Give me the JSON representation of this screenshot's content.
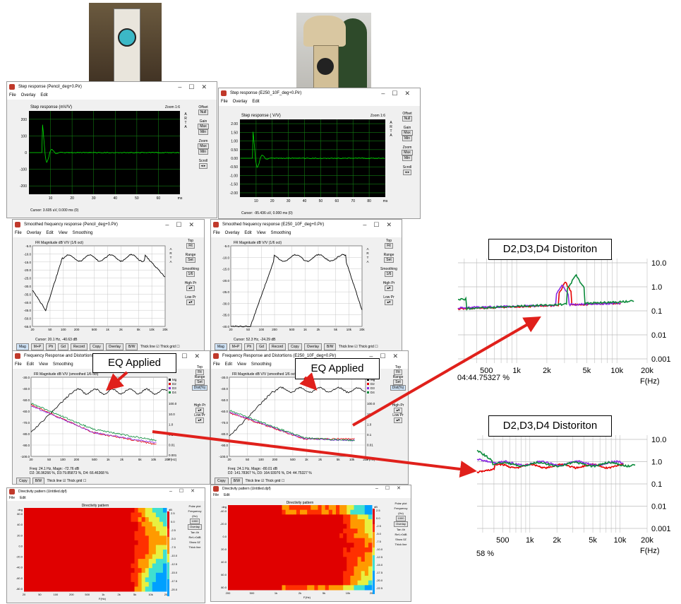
{
  "photos": {
    "left_alt": "pencil speaker photo",
    "right_alt": "horn speaker photo"
  },
  "step_left": {
    "title": "Step response (Pencil_deg+0.Pir)",
    "menu": [
      "File",
      "Overlay",
      "Edit"
    ],
    "plot_title": "Step response (mV/V)",
    "zoom": "Zoom 1:6",
    "y_ticks": [
      "200",
      "100",
      "0",
      "-100",
      "-200"
    ],
    "x_ticks": [
      "10",
      "20",
      "30",
      "40",
      "50",
      "60",
      "ms"
    ],
    "cursor": "Cursor:  3.605 uV,  0.000 ms  (0)",
    "side": {
      "offset": "Offset",
      "null": "Null",
      "gain": "Gain",
      "max": "Max",
      "min": "Min",
      "zoom": "Zoom",
      "scroll": "Scroll"
    }
  },
  "step_right": {
    "title": "Step response (E250_10F_deg+0.Pir)",
    "menu": [
      "File",
      "Overlay",
      "Edit"
    ],
    "plot_title": "Step response ( V/V)",
    "zoom": "Zoom 1:6",
    "y_ticks": [
      "2.00",
      "1.50",
      "1.00",
      "0.50",
      "0.00",
      "-0.50",
      "-1.00",
      "-1.50",
      "-2.00"
    ],
    "x_ticks": [
      "10",
      "20",
      "30",
      "40",
      "50",
      "60",
      "70",
      "80",
      "ms"
    ],
    "cursor": "Cursor:  -95.436 uV,  0.000 ms  (0)",
    "side": {
      "offset": "Offset",
      "null": "Null",
      "gain": "Gain",
      "max": "Max",
      "min": "Min",
      "zoom": "Zoom",
      "scroll": "Scroll"
    }
  },
  "fr_left": {
    "title": "Smoothed frequency response (Pencil_deg+0.Pir)",
    "menu": [
      "File",
      "Overlay",
      "Edit",
      "View",
      "Smoothing"
    ],
    "plot_title": "FR Magnitude dB V/V (1/6 oct)",
    "y_ticks": [
      "-5.0",
      "-10.0",
      "-15.0",
      "-20.0",
      "-25.0",
      "-30.0",
      "-35.0",
      "-40.0",
      "-45.0",
      "-50.0",
      "-55.0"
    ],
    "x_ticks": [
      "20",
      "50",
      "100",
      "200",
      "500",
      "1k",
      "2k",
      "5k",
      "10k",
      "20k"
    ],
    "cursor": "Cursor: 20.1 Hz, -40.63 dB",
    "toolbar": [
      "Mag",
      "M+P",
      "Ph",
      "Gd",
      "Record",
      "Copy",
      "Overlay",
      "B/W",
      "Thick line",
      "Thick grid"
    ],
    "side": {
      "top": "Top",
      "fit": "Fit",
      "range": "Range",
      "set": "Set",
      "smoothing": "Smoothing",
      "smooth_val": "1/6",
      "high": "High Pr",
      "low": "Low Pr"
    }
  },
  "fr_right": {
    "title": "Smoothed frequency response (E250_10F_deg+0.Pir)",
    "menu": [
      "File",
      "Overlay",
      "Edit",
      "View",
      "Smoothing"
    ],
    "plot_title": "FR Magnitude dB V/V (1/6 oct)",
    "y_ticks": [
      "-5.0",
      "-10.0",
      "-15.0",
      "-20.0",
      "-25.0",
      "-30.0",
      "-35.0",
      "-40.0"
    ],
    "x_ticks": [
      "20",
      "50",
      "100",
      "200",
      "500",
      "1k",
      "2k",
      "5k",
      "10k",
      "20k"
    ],
    "cursor": "Cursor: 52.3 Hz, -24.29 dB",
    "toolbar": [
      "Mag",
      "M+P",
      "Ph",
      "Gd",
      "Record",
      "Copy",
      "Overlay",
      "B/W",
      "Thick line",
      "Thick grid"
    ],
    "side": {
      "top": "Top",
      "fit": "Fit",
      "range": "Range",
      "set": "Set",
      "smoothing": "Smoothing",
      "smooth_val": "1/6",
      "high": "High Pr",
      "low": "Low Pr"
    }
  },
  "dist_left": {
    "title": "Frequency Response and Distortions (Distortion.Pir)",
    "menu": [
      "File",
      "Edit",
      "View",
      "Smoothing"
    ],
    "plot_title": "FR Magnitude dB V/V (smoothed 1/6 oct)",
    "y_ticks": [
      "-30.0",
      "-40.0",
      "-50.0",
      "-60.0",
      "-70.0",
      "-80.0",
      "-90.0",
      "-100.0"
    ],
    "r_ticks": [
      "100.0",
      "10.0",
      "1.0",
      "0.1",
      "0.01",
      "0.001"
    ],
    "x_ticks": [
      "20",
      "50",
      "100",
      "200",
      "500",
      "1k",
      "2k",
      "5k",
      "10k",
      "20k"
    ],
    "xunit": "F(Hz)",
    "legend": [
      "Mg",
      "D2",
      "D3",
      "D4"
    ],
    "freq_line": "Freq: 24.1 Hz, Magn: -72.76 dB",
    "dist_line": "D2: 36.96266 %,  D3:79.85873 %,  D4: 66.46368 %",
    "toolbar": [
      "Copy",
      "B/W",
      "Thick line",
      "Thick grid"
    ],
    "side": {
      "top": "Top",
      "fit": "Fit",
      "range": "Range",
      "set": "Set",
      "dist": "Dist(%)",
      "high": "High Pr",
      "low": "Low Pr"
    }
  },
  "dist_right": {
    "title": "Frequency Response and Distortions (E250_10F_deg+0.Pir)",
    "menu": [
      "File",
      "Edit",
      "View",
      "Smoothing"
    ],
    "plot_title": "FR Magnitude dB V/V (smoothed 1/6 oct)",
    "y_ticks": [
      "-30.0",
      "-40.0",
      "-50.0",
      "-60.0",
      "-70.0",
      "-80.0",
      "-90.0",
      "-100.0"
    ],
    "r_ticks": [
      "100.0",
      "10.0",
      "1.0",
      "0.1",
      "0.01"
    ],
    "x_ticks": [
      "20",
      "50",
      "100",
      "200",
      "500",
      "1k",
      "2k",
      "5k",
      "10k",
      "20k"
    ],
    "xunit": "F(Hz)",
    "legend": [
      "Mg",
      "D2",
      "D3",
      "D4"
    ],
    "freq_line": "Freq: 24.1 Hz, Magn: -80.01 dB",
    "dist_line": "D2: 141.78367 %,  D3: 164.93976 %,  D4: 44.75327 %",
    "toolbar": [
      "Copy",
      "B/W",
      "Thick line",
      "Thick grid"
    ],
    "side": {
      "top": "Top",
      "fit": "Fit",
      "range": "Range",
      "set": "Set",
      "dist": "Dist(%)",
      "high": "High Pr",
      "low": "Low Pr"
    }
  },
  "dir_left": {
    "title": "Directivity pattern (Untitled.dpf)",
    "menu": [
      "File",
      "Edit"
    ],
    "plot_title": "Directivity pattern",
    "y_label": "deg",
    "y_ticks": [
      "60.0",
      "40.0",
      "20.0",
      "0.0",
      "-20.0",
      "-40.0",
      "-60.0",
      "-80.0"
    ],
    "x_ticks": [
      "20",
      "50",
      "100",
      "200",
      "500",
      "1k",
      "2k",
      "5k",
      "10k",
      "20k"
    ],
    "x_unit": "F(Hz)",
    "scale_unit": "dB",
    "scale": [
      "2.5",
      "0.0",
      "-2.5",
      "-5.0",
      "-7.5",
      "-10.0",
      "-12.5",
      "-15.0",
      "-17.5",
      "-20.0"
    ],
    "side": [
      "Polar plot",
      "Frequency (Hz)",
      "1000",
      "Overlay",
      "Tan 4h",
      "Ref->0dB",
      "Show 0Z",
      "Thick line"
    ]
  },
  "dir_right": {
    "title": "Directivity pattern (Untitled.dpf)",
    "menu": [
      "File",
      "Edit"
    ],
    "plot_title": "Directivity pattern",
    "y_label": "deg",
    "y_ticks": [
      "-40.0",
      "-20.0",
      "0.0",
      "20.0",
      "40.0",
      "60.0",
      "80.0"
    ],
    "x_ticks": [
      "200",
      "500",
      "1k",
      "2k",
      "5k",
      "10k",
      "20k"
    ],
    "x_unit": "F(Hz)",
    "scale_unit": "dB",
    "scale": [
      "2.5",
      "0.0",
      "-2.5",
      "-5.0",
      "-7.5",
      "-10.0",
      "-12.5",
      "-15.0",
      "-17.5",
      "-20.0",
      "-22.5"
    ],
    "side": [
      "Polar plot",
      "Frequency (Hz)",
      "1000",
      "Overlay",
      "Tan 4h",
      "Ref->0dB",
      "Show 0Z",
      "Thick line"
    ]
  },
  "callouts": {
    "eq_left": "EQ Applied",
    "eq_right": "EQ Applied",
    "dist_top": "D2,D3,D4 Distoriton",
    "dist_bottom": "D2,D3,D4 Distoriton"
  },
  "zoom_top": {
    "x_ticks": [
      "500",
      "1k",
      "2k",
      "5k",
      "10k",
      "20k"
    ],
    "y_ticks": [
      "10.0",
      "1.0",
      "0.1",
      "0.01",
      "0.001"
    ],
    "xunit": "F(Hz)",
    "readout": "04:44.75327 %"
  },
  "zoom_bottom": {
    "x_ticks": [
      "500",
      "1k",
      "2k",
      "5k",
      "10k",
      "20k"
    ],
    "y_ticks": [
      "10.0",
      "1.0",
      "0.1",
      "0.01",
      "0.001"
    ],
    "xunit": "F(Hz)",
    "readout": "58 %"
  },
  "colors": {
    "arrow": "#e0201b",
    "step_trace": "#00e000",
    "plot_black": "#000000",
    "d2": "#e60000",
    "d3": "#8a2be2",
    "d4": "#0a8a3a"
  }
}
